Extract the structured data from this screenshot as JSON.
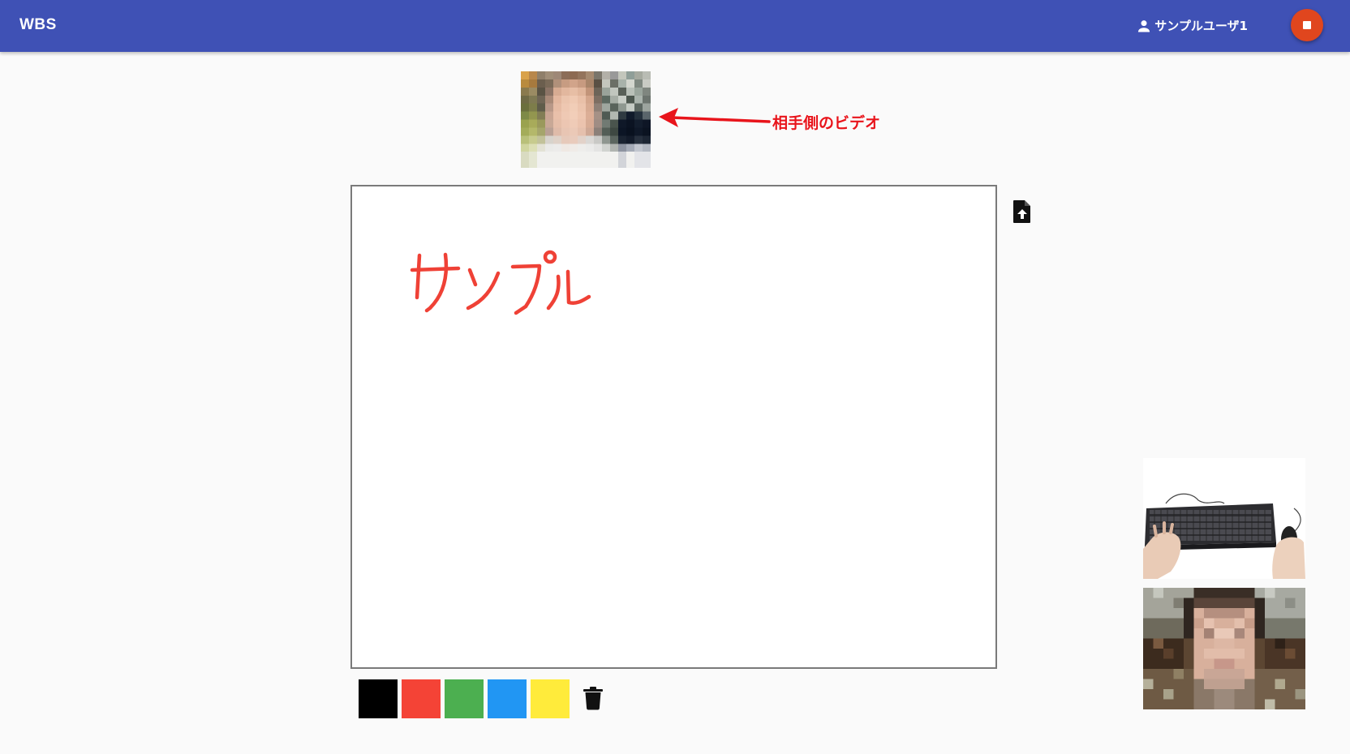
{
  "appbar": {
    "title": "WBS",
    "user_name": "サンプルユーザ1",
    "user_icon": "person-icon",
    "stop_icon": "stop-icon",
    "background_color": "#3f51b5",
    "stop_button_color": "#e0461e"
  },
  "remote_video": {
    "annotation": "相手側のビデオ",
    "annotation_color": "#e8141b"
  },
  "whiteboard": {
    "handwritten_text": "サンプル",
    "ink_color": "#ef4136",
    "upload_icon": "file-upload-icon"
  },
  "palette": {
    "colors": [
      "#000000",
      "#f44336",
      "#4caf50",
      "#2196f3",
      "#ffeb3b"
    ],
    "clear_icon": "trash-icon"
  }
}
